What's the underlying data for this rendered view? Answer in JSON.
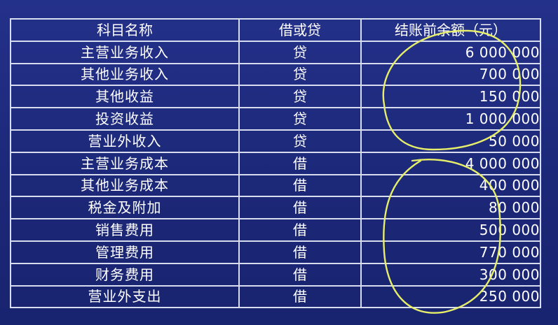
{
  "table": {
    "headers": {
      "name": "科目名称",
      "dc": "借或贷",
      "amount": "结账前余额（元）"
    },
    "rows": [
      {
        "name": "主营业务收入",
        "dc": "贷",
        "amount": "6 000 000"
      },
      {
        "name": "其他业务收入",
        "dc": "贷",
        "amount": "700 000"
      },
      {
        "name": "其他收益",
        "dc": "贷",
        "amount": "150 000"
      },
      {
        "name": "投资收益",
        "dc": "贷",
        "amount": "1 000 000"
      },
      {
        "name": "营业外收入",
        "dc": "贷",
        "amount": "50 000"
      },
      {
        "name": "主营业务成本",
        "dc": "借",
        "amount": "4 000 000"
      },
      {
        "name": "其他业务成本",
        "dc": "借",
        "amount": "400 000"
      },
      {
        "name": "税金及附加",
        "dc": "借",
        "amount": "80 000"
      },
      {
        "name": "销售费用",
        "dc": "借",
        "amount": "500 000"
      },
      {
        "name": "管理费用",
        "dc": "借",
        "amount": "770 000"
      },
      {
        "name": "财务费用",
        "dc": "借",
        "amount": "300 000"
      },
      {
        "name": "营业外支出",
        "dc": "借",
        "amount": "250 000"
      }
    ]
  },
  "colors": {
    "background": "#1d2a7e",
    "grid": "#d8dcef",
    "text": "#ffffff",
    "annotation": "#e6ee6a"
  }
}
